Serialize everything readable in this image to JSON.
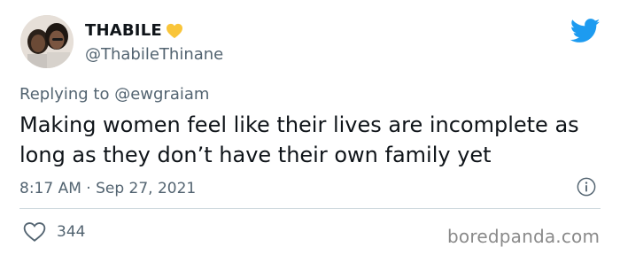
{
  "user": {
    "display_name": "THABILE",
    "handle": "@ThabileThinane"
  },
  "reply": {
    "text": "Replying to @ewgraiam"
  },
  "tweet": {
    "text": "Making women feel like their lives are incomplete as long as they don’t have their own family yet",
    "timestamp": "8:17 AM · Sep 27, 2021"
  },
  "stats": {
    "likes": "344"
  },
  "watermark": "boredpanda.com",
  "icons": {
    "heart": "yellow-heart-icon",
    "logo": "twitter-bird-icon",
    "info": "info-icon",
    "like": "heart-outline-icon"
  },
  "colors": {
    "twitter_blue": "#1d9bf0",
    "heart_yellow": "#f9c53a",
    "secondary_text": "#536471",
    "divider": "#cfd9de"
  }
}
